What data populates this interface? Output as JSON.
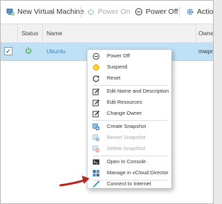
{
  "toolbar": {
    "new_vm_label": "New Virtual Machine",
    "power_on_label": "Power On",
    "power_off_label": "Power Off",
    "actions_label": "Action"
  },
  "table": {
    "columns": [
      "Status",
      "Name",
      "Owne"
    ],
    "rows": [
      {
        "checked": true,
        "status": "powered-on",
        "name": "Ubuntu",
        "owner": "mwpr"
      }
    ]
  },
  "context_menu": {
    "items": [
      {
        "label": "Power Off",
        "icon": "power-off-icon",
        "enabled": true
      },
      {
        "label": "Suspend",
        "icon": "suspend-icon",
        "enabled": true
      },
      {
        "label": "Reset",
        "icon": "reset-icon",
        "enabled": true
      },
      {
        "label": "Edit Name and Description",
        "icon": "edit-icon",
        "enabled": true
      },
      {
        "label": "Edit Resources",
        "icon": "edit-icon",
        "enabled": true
      },
      {
        "label": "Change Owner",
        "icon": "edit-icon",
        "enabled": true
      },
      {
        "label": "Create Snapshot",
        "icon": "snapshot-icon",
        "enabled": true
      },
      {
        "label": "Revert Snapshot",
        "icon": "snapshot-icon",
        "enabled": false
      },
      {
        "label": "Delete Snapshot",
        "icon": "snapshot-icon",
        "enabled": false
      },
      {
        "label": "Open In Console",
        "icon": "console-icon",
        "enabled": true
      },
      {
        "label": "Manage in vCloud Director",
        "icon": "vcloud-icon",
        "enabled": true
      },
      {
        "label": "Connect to Internet",
        "icon": "connect-icon",
        "enabled": true
      }
    ]
  },
  "colors": {
    "selected_row": "#bfe0f5",
    "power_green": "#4caf50",
    "accent_blue": "#1e88c8",
    "arrow_red": "#b3261e"
  }
}
